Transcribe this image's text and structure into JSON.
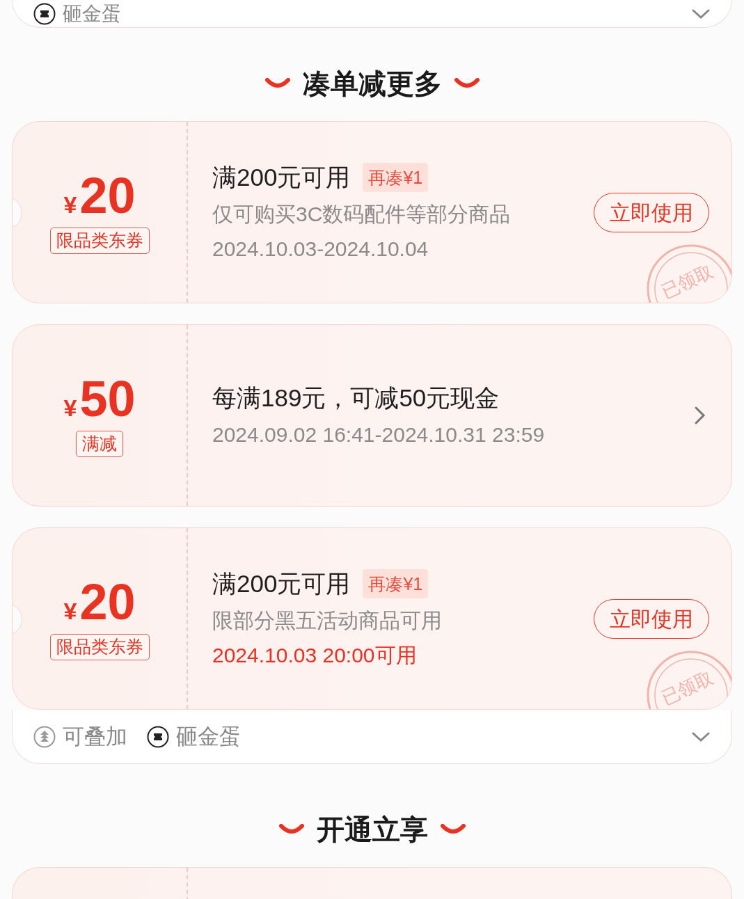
{
  "top_panel": {
    "tags": [
      {
        "kind": "egg",
        "label": "砸金蛋"
      }
    ]
  },
  "sections": [
    {
      "title": "凑单减更多",
      "coupons": [
        {
          "currency": "¥",
          "amount": "20",
          "type_tag": "限品类东券",
          "condition": "满200元可用",
          "badge": "再凑¥1",
          "scope": "仅可购买3C数码配件等部分商品",
          "period": "2024.10.03-2024.10.04",
          "period_highlight": false,
          "notched": true,
          "action": {
            "kind": "button",
            "label": "立即使用"
          },
          "stamp": "已领取"
        },
        {
          "currency": "¥",
          "amount": "50",
          "type_tag": "满减",
          "condition": "每满189元，可减50元现金",
          "period": "2024.09.02 16:41-2024.10.31 23:59",
          "period_highlight": false,
          "notched": false,
          "action": {
            "kind": "chevron"
          }
        },
        {
          "currency": "¥",
          "amount": "20",
          "type_tag": "限品类东券",
          "condition": "满200元可用",
          "badge": "再凑¥1",
          "scope": "限部分黑五活动商品可用",
          "period": "2024.10.03 20:00可用",
          "period_highlight": true,
          "notched": true,
          "action": {
            "kind": "button",
            "label": "立即使用"
          },
          "stamp": "已领取"
        }
      ],
      "footer": {
        "tags": [
          {
            "kind": "stack",
            "label": "可叠加"
          },
          {
            "kind": "egg",
            "label": "砸金蛋"
          }
        ]
      }
    },
    {
      "title": "开通立享",
      "coupons": [
        {
          "kind": "partial"
        }
      ]
    }
  ]
}
